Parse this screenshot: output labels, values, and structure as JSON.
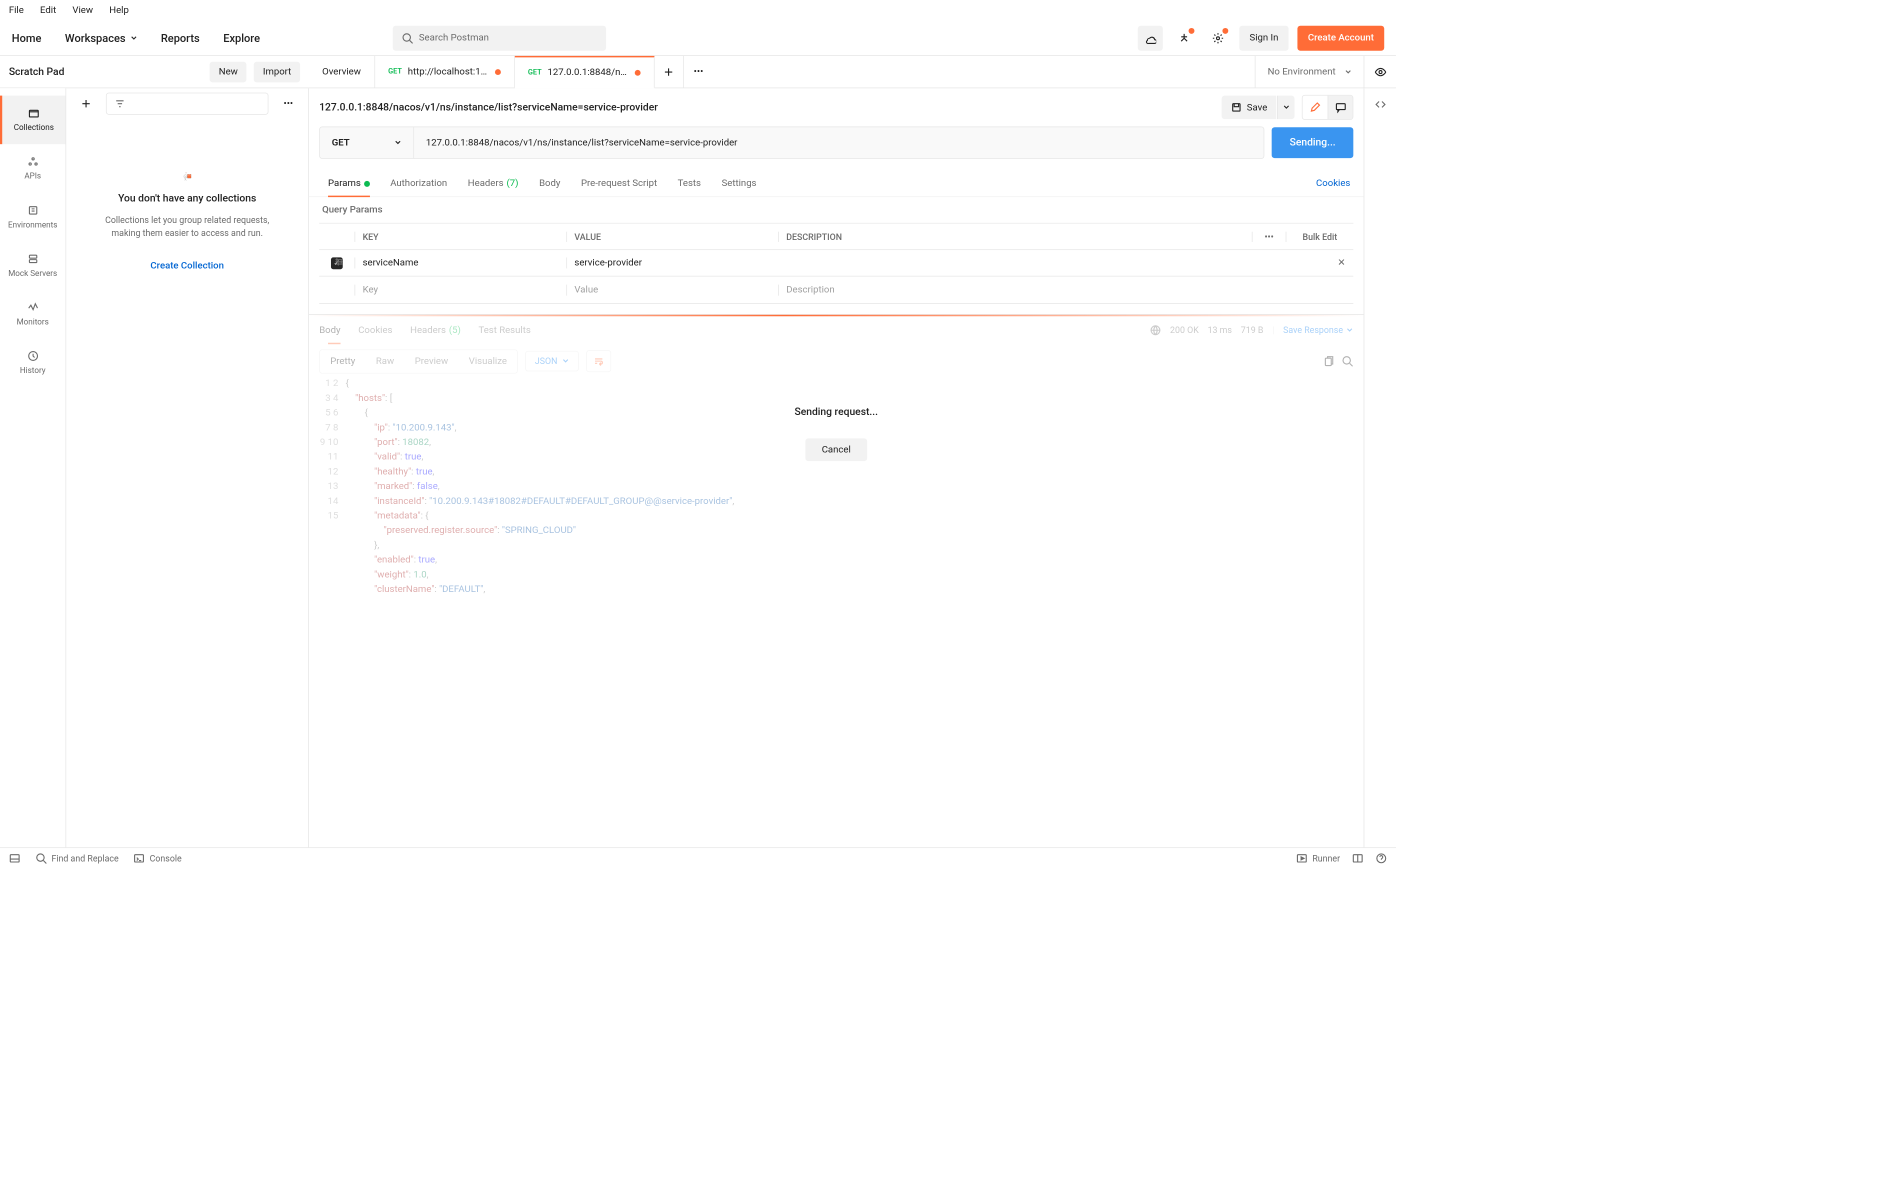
{
  "menubar": [
    "File",
    "Edit",
    "View",
    "Help"
  ],
  "topnav": {
    "home": "Home",
    "workspaces": "Workspaces",
    "reports": "Reports",
    "explore": "Explore",
    "search_placeholder": "Search Postman",
    "signin": "Sign In",
    "create_account": "Create Account"
  },
  "workspace": {
    "title": "Scratch Pad",
    "new_btn": "New",
    "import_btn": "Import"
  },
  "tabs": {
    "overview": "Overview",
    "t1_method": "GET",
    "t1_label": "http://localhost:18...",
    "t2_method": "GET",
    "t2_label": "127.0.0.1:8848/nac..."
  },
  "environment": "No Environment",
  "rail": {
    "collections": "Collections",
    "apis": "APIs",
    "environments": "Environments",
    "mocks": "Mock Servers",
    "monitors": "Monitors",
    "history": "History"
  },
  "sidebar": {
    "empty_title": "You don't have any collections",
    "empty_desc": "Collections let you group related requests, making them easier to access and run.",
    "create": "Create Collection"
  },
  "request": {
    "title": "127.0.0.1:8848/nacos/v1/ns/instance/list?serviceName=service-provider",
    "save": "Save",
    "method": "GET",
    "url": "127.0.0.1:8848/nacos/v1/ns/instance/list?serviceName=service-provider",
    "send": "Sending..."
  },
  "reqtabs": {
    "params": "Params",
    "auth": "Authorization",
    "headers": "Headers",
    "headers_count": "(7)",
    "body": "Body",
    "prereq": "Pre-request Script",
    "tests": "Tests",
    "settings": "Settings",
    "cookies": "Cookies"
  },
  "query": {
    "section": "Query Params",
    "h_key": "KEY",
    "h_value": "VALUE",
    "h_desc": "DESCRIPTION",
    "bulk": "Bulk Edit",
    "rows": [
      {
        "key": "serviceName",
        "value": "service-provider",
        "desc": ""
      }
    ],
    "ph_key": "Key",
    "ph_value": "Value",
    "ph_desc": "Description"
  },
  "response": {
    "tabs": {
      "body": "Body",
      "cookies": "Cookies",
      "headers": "Headers",
      "headers_count": "(5)",
      "tests": "Test Results"
    },
    "status": "200 OK",
    "time": "13 ms",
    "size": "719 B",
    "save": "Save Response",
    "view": {
      "pretty": "Pretty",
      "raw": "Raw",
      "preview": "Preview",
      "visualize": "Visualize",
      "format": "JSON"
    },
    "json": {
      "hosts": [
        {
          "ip": "10.200.9.143",
          "port": 18082,
          "valid": true,
          "healthy": true,
          "marked": false,
          "instanceId": "10.200.9.143#18082#DEFAULT#DEFAULT_GROUP@@service-provider",
          "metadata": {
            "preserved.register.source": "SPRING_CLOUD"
          },
          "enabled": true,
          "weight": 1.0,
          "clusterName": "DEFAULT"
        }
      ]
    }
  },
  "overlay": {
    "sending": "Sending request...",
    "cancel": "Cancel"
  },
  "statusbar": {
    "find": "Find and Replace",
    "console": "Console",
    "runner": "Runner"
  }
}
